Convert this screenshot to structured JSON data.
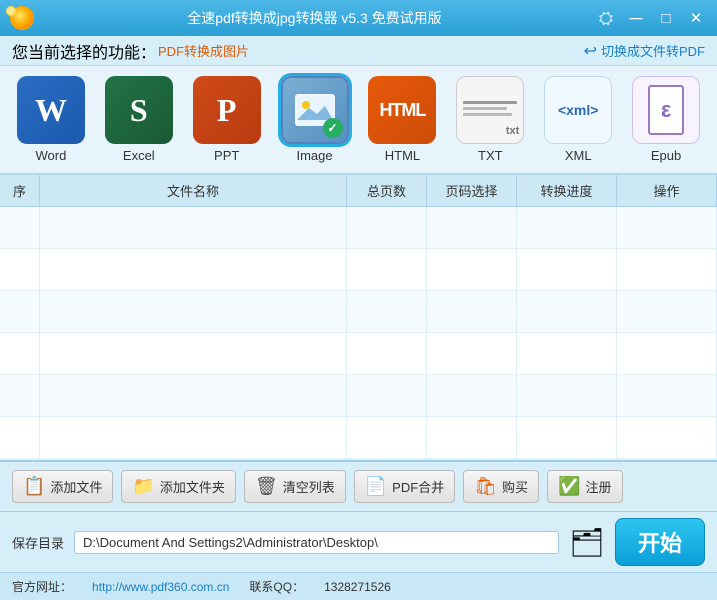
{
  "titlebar": {
    "title": "全速pdf转换成jpg转换器 v5.3 免费试用版",
    "logo_char": "⬤",
    "min_label": "─",
    "max_label": "□",
    "close_label": "✕"
  },
  "subtitlebar": {
    "prefix": "您当前选择的功能：",
    "func_name": "PDF转换成图片",
    "switch_label": "切换成文件转PDF"
  },
  "formats": [
    {
      "id": "word",
      "label": "Word",
      "type": "word",
      "text": "W"
    },
    {
      "id": "excel",
      "label": "Excel",
      "type": "excel",
      "text": "S"
    },
    {
      "id": "ppt",
      "label": "PPT",
      "type": "ppt",
      "text": "P"
    },
    {
      "id": "image",
      "label": "Image",
      "type": "image",
      "text": "🖼",
      "selected": true
    },
    {
      "id": "html",
      "label": "HTML",
      "type": "html",
      "text": "HTML"
    },
    {
      "id": "txt",
      "label": "TXT",
      "type": "txt",
      "text": "txt"
    },
    {
      "id": "xml",
      "label": "XML",
      "type": "xml",
      "text": "xml>"
    },
    {
      "id": "epub",
      "label": "Epub",
      "type": "epub",
      "text": "ε"
    }
  ],
  "table": {
    "headers": [
      "序",
      "文件名称",
      "总页数",
      "页码选择",
      "转换进度",
      "操作"
    ],
    "rows": []
  },
  "toolbar": {
    "add_file": "添加文件",
    "add_folder": "添加文件夹",
    "clear_list": "清空列表",
    "pdf_merge": "PDF合并",
    "buy": "购买",
    "register": "注册"
  },
  "savedir": {
    "label": "保存目录",
    "path": "D:\\Document And Settings2\\Administrator\\Desktop\\"
  },
  "start_btn": "开始",
  "footer": {
    "website_label": "官方网址：",
    "website_url": "http://www.pdf360.com.cn",
    "qq_label": "联系QQ：",
    "qq_number": "1328271526"
  }
}
